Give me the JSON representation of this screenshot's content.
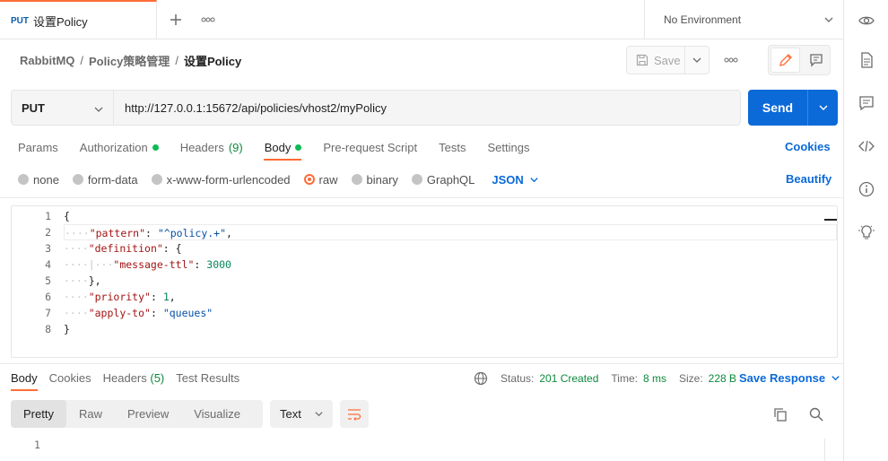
{
  "tab": {
    "method": "PUT",
    "name": "设置Policy"
  },
  "environment": {
    "label": "No Environment"
  },
  "breadcrumb": {
    "collection": "RabbitMQ",
    "folder": "Policy策略管理",
    "request": "设置Policy"
  },
  "toolbar": {
    "save_label": "Save"
  },
  "request": {
    "method": "PUT",
    "url": "http://127.0.0.1:15672/api/policies/vhost2/myPolicy",
    "send_label": "Send"
  },
  "request_tabs": {
    "params": "Params",
    "authorization": "Authorization",
    "headers": "Headers",
    "headers_count": "(9)",
    "body": "Body",
    "prerequest": "Pre-request Script",
    "tests": "Tests",
    "settings": "Settings",
    "cookies": "Cookies"
  },
  "body_types": {
    "none": "none",
    "form_data": "form-data",
    "urlencoded": "x-www-form-urlencoded",
    "raw": "raw",
    "binary": "binary",
    "graphql": "GraphQL",
    "format": "JSON",
    "beautify": "Beautify"
  },
  "editor": {
    "line_numbers": [
      "1",
      "2",
      "3",
      "4",
      "5",
      "6",
      "7",
      "8"
    ],
    "lines": [
      {
        "indent": "",
        "parts": [
          [
            "p",
            "{"
          ]
        ]
      },
      {
        "indent": "····",
        "parts": [
          [
            "k",
            "\"pattern\""
          ],
          [
            "p",
            ": "
          ],
          [
            "s",
            "\"^policy.+\""
          ],
          [
            "p",
            ","
          ]
        ]
      },
      {
        "indent": "····",
        "parts": [
          [
            "k",
            "\"definition\""
          ],
          [
            "p",
            ": {"
          ]
        ]
      },
      {
        "indent": "····|···",
        "parts": [
          [
            "k",
            "\"message-ttl\""
          ],
          [
            "p",
            ": "
          ],
          [
            "n",
            "3000"
          ]
        ]
      },
      {
        "indent": "····",
        "parts": [
          [
            "p",
            "},"
          ]
        ]
      },
      {
        "indent": "····",
        "parts": [
          [
            "k",
            "\"priority\""
          ],
          [
            "p",
            ": "
          ],
          [
            "n",
            "1"
          ],
          [
            "p",
            ", "
          ]
        ]
      },
      {
        "indent": "····",
        "parts": [
          [
            "k",
            "\"apply-to\""
          ],
          [
            "p",
            ": "
          ],
          [
            "s",
            "\"queues\""
          ]
        ]
      },
      {
        "indent": "",
        "parts": [
          [
            "p",
            "}"
          ]
        ]
      }
    ]
  },
  "response_tabs": {
    "body": "Body",
    "cookies": "Cookies",
    "headers": "Headers",
    "headers_count": "(5)",
    "test_results": "Test Results"
  },
  "response_status": {
    "status_label": "Status:",
    "status_value": "201 Created",
    "time_label": "Time:",
    "time_value": "8 ms",
    "size_label": "Size:",
    "size_value": "228 B",
    "save_response": "Save Response"
  },
  "response_view": {
    "pretty": "Pretty",
    "raw": "Raw",
    "preview": "Preview",
    "visualize": "Visualize",
    "format": "Text",
    "line1": "1"
  },
  "colors": {
    "accent": "#ff6c37",
    "primary": "#0b6ad8",
    "success": "#0c8a3c"
  }
}
